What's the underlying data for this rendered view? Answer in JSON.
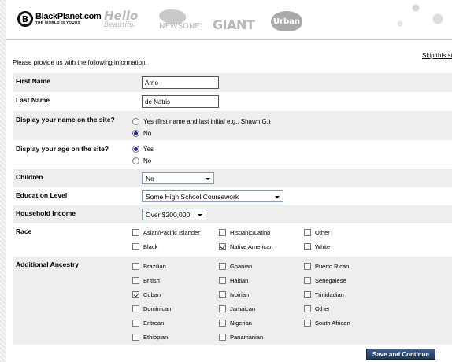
{
  "header": {
    "brand_name": "BlackPlanet.com",
    "brand_tagline": "THE WORLD IS YOURS",
    "logos": [
      "Hello",
      "Beautiful",
      "NEWSONE",
      "GIANT",
      "Urban"
    ]
  },
  "skip_link": "Skip this st",
  "intro": "Please provide us with the following information.",
  "first_name": {
    "label": "First Name",
    "value": "Arno"
  },
  "last_name": {
    "label": "Last Name",
    "value": "de Natris"
  },
  "display_name": {
    "label": "Display your name on the site?",
    "options": [
      "Yes (first name and last initial e.g., Shawn G.)",
      "No"
    ],
    "selected": "No"
  },
  "display_age": {
    "label": "Display your age on the site?",
    "options": [
      "Yes",
      "No"
    ],
    "selected": "Yes"
  },
  "children": {
    "label": "Children",
    "value": "No"
  },
  "education": {
    "label": "Education Level",
    "value": "Some High School Coursework"
  },
  "income": {
    "label": "Household Income",
    "value": "Over $200,000"
  },
  "race": {
    "label": "Race",
    "options": [
      {
        "label": "Asian/Pacific Islander",
        "checked": false
      },
      {
        "label": "Hispanic/Latino",
        "checked": false
      },
      {
        "label": "Other",
        "checked": false
      },
      {
        "label": "Black",
        "checked": false
      },
      {
        "label": "Native American",
        "checked": true
      },
      {
        "label": "White",
        "checked": false
      }
    ]
  },
  "ancestry": {
    "label": "Additional Ancestry",
    "options": [
      {
        "label": "Brazilian",
        "checked": false
      },
      {
        "label": "Ghanian",
        "checked": false
      },
      {
        "label": "Puerto Rican",
        "checked": false
      },
      {
        "label": "British",
        "checked": false
      },
      {
        "label": "Haitian",
        "checked": false
      },
      {
        "label": "Senegalese",
        "checked": false
      },
      {
        "label": "Cuban",
        "checked": true
      },
      {
        "label": "Ivoirian",
        "checked": false
      },
      {
        "label": "Trinidadian",
        "checked": false
      },
      {
        "label": "Dominican",
        "checked": false
      },
      {
        "label": "Jamaican",
        "checked": false
      },
      {
        "label": "Other",
        "checked": false
      },
      {
        "label": "Eritrean",
        "checked": false
      },
      {
        "label": "Nigerian",
        "checked": false
      },
      {
        "label": "South African",
        "checked": false
      },
      {
        "label": "Ethiopian",
        "checked": false
      },
      {
        "label": "Panamanian",
        "checked": false
      }
    ]
  },
  "submit_label": "Save and Continue"
}
